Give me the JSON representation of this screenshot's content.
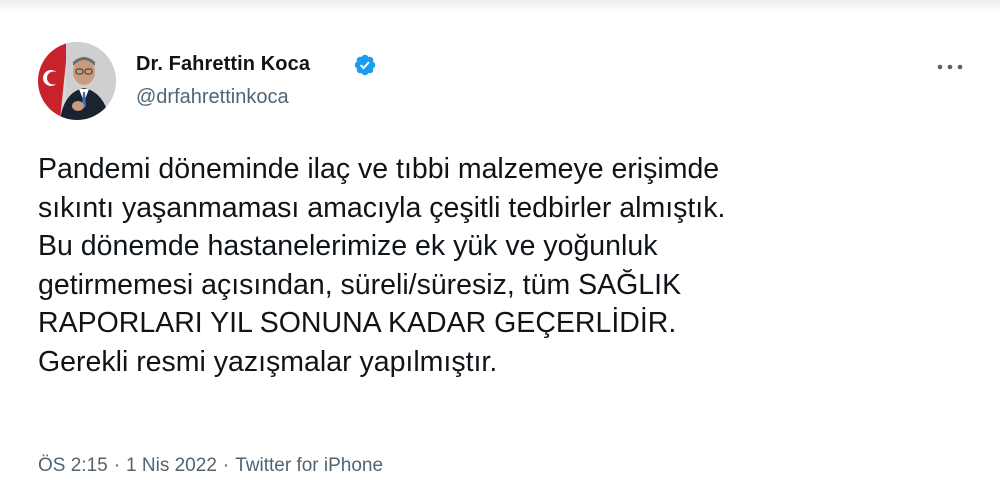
{
  "tweet": {
    "author": {
      "name": "Dr. Fahrettin Koca",
      "handle": "@drfahrettinkoca",
      "verified": true,
      "verified_icon": "verified-badge-icon"
    },
    "text_lines": [
      "Pandemi döneminde ilaç ve tıbbi malzemeye erişimde",
      "sıkıntı yaşanmaması amacıyla çeşitli tedbirler almıştık.",
      "Bu dönemde hastanelerimize ek yük ve yoğunluk",
      "getirmemesi açısından, süreli/süresiz, tüm SAĞLIK",
      "RAPORLARI YIL SONUNA KADAR GEÇERLİDİR.",
      "Gerekli resmi yazışmalar yapılmıştır."
    ],
    "time": "ÖS 2:15",
    "separator": "·",
    "date": "1 Nis 2022",
    "source": "Twitter for iPhone",
    "more_icon": "more-horizontal-icon"
  },
  "colors": {
    "text": "#0f1419",
    "secondary": "#536471",
    "verified": "#1d9bf0"
  }
}
